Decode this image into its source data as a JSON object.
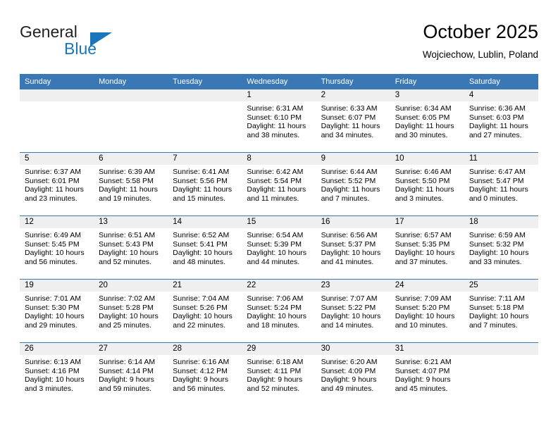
{
  "brand": {
    "name_part1": "General",
    "name_part2": "Blue",
    "logo_icon": "triangle-logo-icon"
  },
  "header": {
    "title": "October 2025",
    "subtitle": "Wojciechow, Lublin, Poland"
  },
  "colors": {
    "header_blue": "#3a77b5",
    "brand_blue": "#1b75bb",
    "daynum_band": "#efefef",
    "text": "#000000"
  },
  "calendar": {
    "weekday_headers": [
      "Sunday",
      "Monday",
      "Tuesday",
      "Wednesday",
      "Thursday",
      "Friday",
      "Saturday"
    ],
    "weeks": [
      [
        {
          "day": "",
          "blank": true,
          "line1": "",
          "line2": "",
          "line3": "",
          "line4": ""
        },
        {
          "day": "",
          "blank": true,
          "line1": "",
          "line2": "",
          "line3": "",
          "line4": ""
        },
        {
          "day": "",
          "blank": true,
          "line1": "",
          "line2": "",
          "line3": "",
          "line4": ""
        },
        {
          "day": "1",
          "blank": false,
          "line1": "Sunrise: 6:31 AM",
          "line2": "Sunset: 6:10 PM",
          "line3": "Daylight: 11 hours",
          "line4": "and 38 minutes."
        },
        {
          "day": "2",
          "blank": false,
          "line1": "Sunrise: 6:33 AM",
          "line2": "Sunset: 6:07 PM",
          "line3": "Daylight: 11 hours",
          "line4": "and 34 minutes."
        },
        {
          "day": "3",
          "blank": false,
          "line1": "Sunrise: 6:34 AM",
          "line2": "Sunset: 6:05 PM",
          "line3": "Daylight: 11 hours",
          "line4": "and 30 minutes."
        },
        {
          "day": "4",
          "blank": false,
          "line1": "Sunrise: 6:36 AM",
          "line2": "Sunset: 6:03 PM",
          "line3": "Daylight: 11 hours",
          "line4": "and 27 minutes."
        }
      ],
      [
        {
          "day": "5",
          "blank": false,
          "line1": "Sunrise: 6:37 AM",
          "line2": "Sunset: 6:01 PM",
          "line3": "Daylight: 11 hours",
          "line4": "and 23 minutes."
        },
        {
          "day": "6",
          "blank": false,
          "line1": "Sunrise: 6:39 AM",
          "line2": "Sunset: 5:58 PM",
          "line3": "Daylight: 11 hours",
          "line4": "and 19 minutes."
        },
        {
          "day": "7",
          "blank": false,
          "line1": "Sunrise: 6:41 AM",
          "line2": "Sunset: 5:56 PM",
          "line3": "Daylight: 11 hours",
          "line4": "and 15 minutes."
        },
        {
          "day": "8",
          "blank": false,
          "line1": "Sunrise: 6:42 AM",
          "line2": "Sunset: 5:54 PM",
          "line3": "Daylight: 11 hours",
          "line4": "and 11 minutes."
        },
        {
          "day": "9",
          "blank": false,
          "line1": "Sunrise: 6:44 AM",
          "line2": "Sunset: 5:52 PM",
          "line3": "Daylight: 11 hours",
          "line4": "and 7 minutes."
        },
        {
          "day": "10",
          "blank": false,
          "line1": "Sunrise: 6:46 AM",
          "line2": "Sunset: 5:50 PM",
          "line3": "Daylight: 11 hours",
          "line4": "and 3 minutes."
        },
        {
          "day": "11",
          "blank": false,
          "line1": "Sunrise: 6:47 AM",
          "line2": "Sunset: 5:47 PM",
          "line3": "Daylight: 11 hours",
          "line4": "and 0 minutes."
        }
      ],
      [
        {
          "day": "12",
          "blank": false,
          "line1": "Sunrise: 6:49 AM",
          "line2": "Sunset: 5:45 PM",
          "line3": "Daylight: 10 hours",
          "line4": "and 56 minutes."
        },
        {
          "day": "13",
          "blank": false,
          "line1": "Sunrise: 6:51 AM",
          "line2": "Sunset: 5:43 PM",
          "line3": "Daylight: 10 hours",
          "line4": "and 52 minutes."
        },
        {
          "day": "14",
          "blank": false,
          "line1": "Sunrise: 6:52 AM",
          "line2": "Sunset: 5:41 PM",
          "line3": "Daylight: 10 hours",
          "line4": "and 48 minutes."
        },
        {
          "day": "15",
          "blank": false,
          "line1": "Sunrise: 6:54 AM",
          "line2": "Sunset: 5:39 PM",
          "line3": "Daylight: 10 hours",
          "line4": "and 44 minutes."
        },
        {
          "day": "16",
          "blank": false,
          "line1": "Sunrise: 6:56 AM",
          "line2": "Sunset: 5:37 PM",
          "line3": "Daylight: 10 hours",
          "line4": "and 41 minutes."
        },
        {
          "day": "17",
          "blank": false,
          "line1": "Sunrise: 6:57 AM",
          "line2": "Sunset: 5:35 PM",
          "line3": "Daylight: 10 hours",
          "line4": "and 37 minutes."
        },
        {
          "day": "18",
          "blank": false,
          "line1": "Sunrise: 6:59 AM",
          "line2": "Sunset: 5:32 PM",
          "line3": "Daylight: 10 hours",
          "line4": "and 33 minutes."
        }
      ],
      [
        {
          "day": "19",
          "blank": false,
          "line1": "Sunrise: 7:01 AM",
          "line2": "Sunset: 5:30 PM",
          "line3": "Daylight: 10 hours",
          "line4": "and 29 minutes."
        },
        {
          "day": "20",
          "blank": false,
          "line1": "Sunrise: 7:02 AM",
          "line2": "Sunset: 5:28 PM",
          "line3": "Daylight: 10 hours",
          "line4": "and 25 minutes."
        },
        {
          "day": "21",
          "blank": false,
          "line1": "Sunrise: 7:04 AM",
          "line2": "Sunset: 5:26 PM",
          "line3": "Daylight: 10 hours",
          "line4": "and 22 minutes."
        },
        {
          "day": "22",
          "blank": false,
          "line1": "Sunrise: 7:06 AM",
          "line2": "Sunset: 5:24 PM",
          "line3": "Daylight: 10 hours",
          "line4": "and 18 minutes."
        },
        {
          "day": "23",
          "blank": false,
          "line1": "Sunrise: 7:07 AM",
          "line2": "Sunset: 5:22 PM",
          "line3": "Daylight: 10 hours",
          "line4": "and 14 minutes."
        },
        {
          "day": "24",
          "blank": false,
          "line1": "Sunrise: 7:09 AM",
          "line2": "Sunset: 5:20 PM",
          "line3": "Daylight: 10 hours",
          "line4": "and 10 minutes."
        },
        {
          "day": "25",
          "blank": false,
          "line1": "Sunrise: 7:11 AM",
          "line2": "Sunset: 5:18 PM",
          "line3": "Daylight: 10 hours",
          "line4": "and 7 minutes."
        }
      ],
      [
        {
          "day": "26",
          "blank": false,
          "line1": "Sunrise: 6:13 AM",
          "line2": "Sunset: 4:16 PM",
          "line3": "Daylight: 10 hours",
          "line4": "and 3 minutes."
        },
        {
          "day": "27",
          "blank": false,
          "line1": "Sunrise: 6:14 AM",
          "line2": "Sunset: 4:14 PM",
          "line3": "Daylight: 9 hours",
          "line4": "and 59 minutes."
        },
        {
          "day": "28",
          "blank": false,
          "line1": "Sunrise: 6:16 AM",
          "line2": "Sunset: 4:12 PM",
          "line3": "Daylight: 9 hours",
          "line4": "and 56 minutes."
        },
        {
          "day": "29",
          "blank": false,
          "line1": "Sunrise: 6:18 AM",
          "line2": "Sunset: 4:11 PM",
          "line3": "Daylight: 9 hours",
          "line4": "and 52 minutes."
        },
        {
          "day": "30",
          "blank": false,
          "line1": "Sunrise: 6:20 AM",
          "line2": "Sunset: 4:09 PM",
          "line3": "Daylight: 9 hours",
          "line4": "and 49 minutes."
        },
        {
          "day": "31",
          "blank": false,
          "line1": "Sunrise: 6:21 AM",
          "line2": "Sunset: 4:07 PM",
          "line3": "Daylight: 9 hours",
          "line4": "and 45 minutes."
        },
        {
          "day": "",
          "blank": true,
          "line1": "",
          "line2": "",
          "line3": "",
          "line4": ""
        }
      ]
    ]
  }
}
